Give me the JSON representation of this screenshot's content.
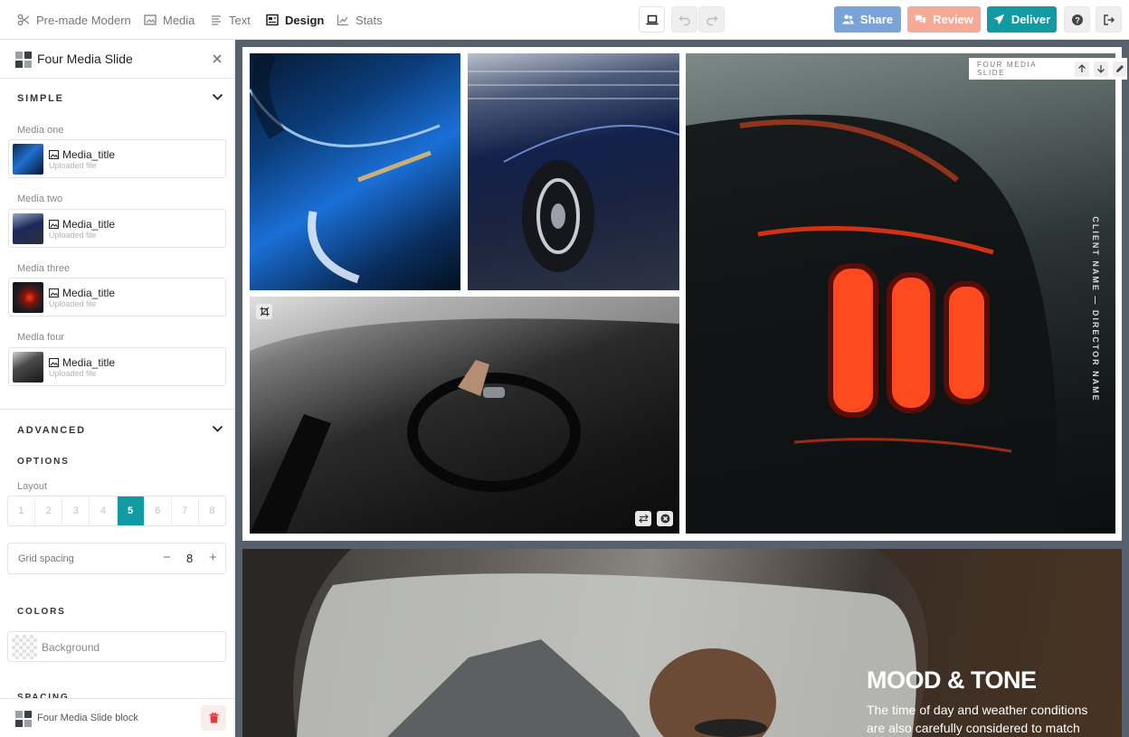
{
  "topbar": {
    "nav": [
      {
        "label": "Pre-made Modern",
        "icon": "scissors-icon"
      },
      {
        "label": "Media",
        "icon": "image-icon"
      },
      {
        "label": "Text",
        "icon": "text-lines-icon"
      },
      {
        "label": "Design",
        "icon": "design-layout-icon",
        "active": true
      },
      {
        "label": "Stats",
        "icon": "chart-icon"
      }
    ],
    "actions": {
      "share": "Share",
      "review": "Review",
      "deliver": "Deliver"
    },
    "colors": {
      "share": "#7aa3d8",
      "review": "#f6a996",
      "deliver": "#129aa3"
    }
  },
  "sidebar": {
    "title": "Four Media Slide",
    "simple": {
      "label": "SIMPLE",
      "media": [
        {
          "label": "Media one",
          "title": "Media_title",
          "sub": "Uploaded file"
        },
        {
          "label": "Media two",
          "title": "Media_title",
          "sub": "Uploaded file"
        },
        {
          "label": "Media three",
          "title": "Media_title",
          "sub": "Uploaded file"
        },
        {
          "label": "Media four",
          "title": "Media_title",
          "sub": "Uploaded file"
        }
      ]
    },
    "advanced": {
      "label": "ADVANCED",
      "options_label": "OPTIONS",
      "layout_label": "Layout",
      "layouts": [
        "1",
        "2",
        "3",
        "4",
        "5",
        "6",
        "7",
        "8"
      ],
      "active_layout": "5",
      "grid_spacing_label": "Grid spacing",
      "grid_spacing_value": "8",
      "minus": "−",
      "plus": "+"
    },
    "colors": {
      "label": "COLORS",
      "background_label": "Background"
    },
    "partial_section": "SPACING",
    "footer_label": "Four Media Slide block"
  },
  "canvas": {
    "slide_label": "FOUR MEDIA SLIDE",
    "vertical_text": "CLIENT NAME — DIRECTOR NAME",
    "mood": {
      "title": "MOOD & TONE",
      "text": "The time of day and weather conditions are also carefully considered to match"
    }
  }
}
